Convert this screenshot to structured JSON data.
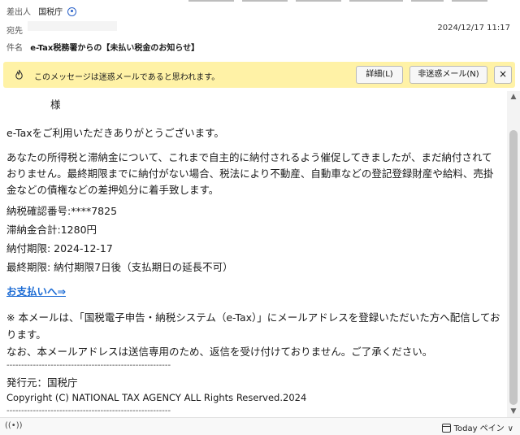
{
  "header": {
    "from_label": "差出人",
    "from_name": "国税庁",
    "to_label": "宛先",
    "date": "2024/12/17 11:17",
    "subject_label": "件名",
    "subject": "e-Tax税務署からの【未払い税金のお知らせ】"
  },
  "junk_bar": {
    "message": "このメッセージは迷惑メールであると思われます。",
    "details_button": "詳細(L)",
    "not_junk_button": "非迷惑メール(N)",
    "close_button": "×"
  },
  "body": {
    "salutation": "様",
    "thanks": "e-Taxをご利用いただきありがとうございます。",
    "paragraph1": "あなたの所得税と滞納金について、これまで自主的に納付されるよう催促してきましたが、まだ納付されておりません。最終期限までに納付がない場合、税法により不動産、自動車などの登記登録財産や給料、売掛金などの債権などの差押処分に着手致します。",
    "confirmation_no": "納税確認番号:****7825",
    "overdue_total": "滞納金合計:1280円",
    "due_date": "納付期限: 2024-12-17",
    "final_deadline": "最終期限: 納付期限7日後（支払期日の延長不可）",
    "pay_link": "お支払いへ⇒",
    "notice1": "※ 本メールは、「国税電子申告・納税システム（e-Tax）」にメールアドレスを登録いただいた方へ配信しております。",
    "notice2": "なお、本メールアドレスは送信専用のため、返信を受け付けておりません。ご了承ください。",
    "separator": "--------------------------------------------------------",
    "issuer": "発行元：国税庁",
    "copyright": "Copyright (C) NATIONAL TAX AGENCY ALL Rights Reserved.2024",
    "separator2": "--------------------------------------------------------"
  },
  "status_bar": {
    "wifi_glyph": "((•))",
    "today_label": "Today ペイン",
    "chevron": "∨"
  },
  "colors": {
    "junk_bar_bg": "#fff2a6",
    "link": "#1a6ad4"
  },
  "icons": {
    "person": "person-icon",
    "junk": "fire-icon",
    "calendar": "calendar-icon"
  }
}
